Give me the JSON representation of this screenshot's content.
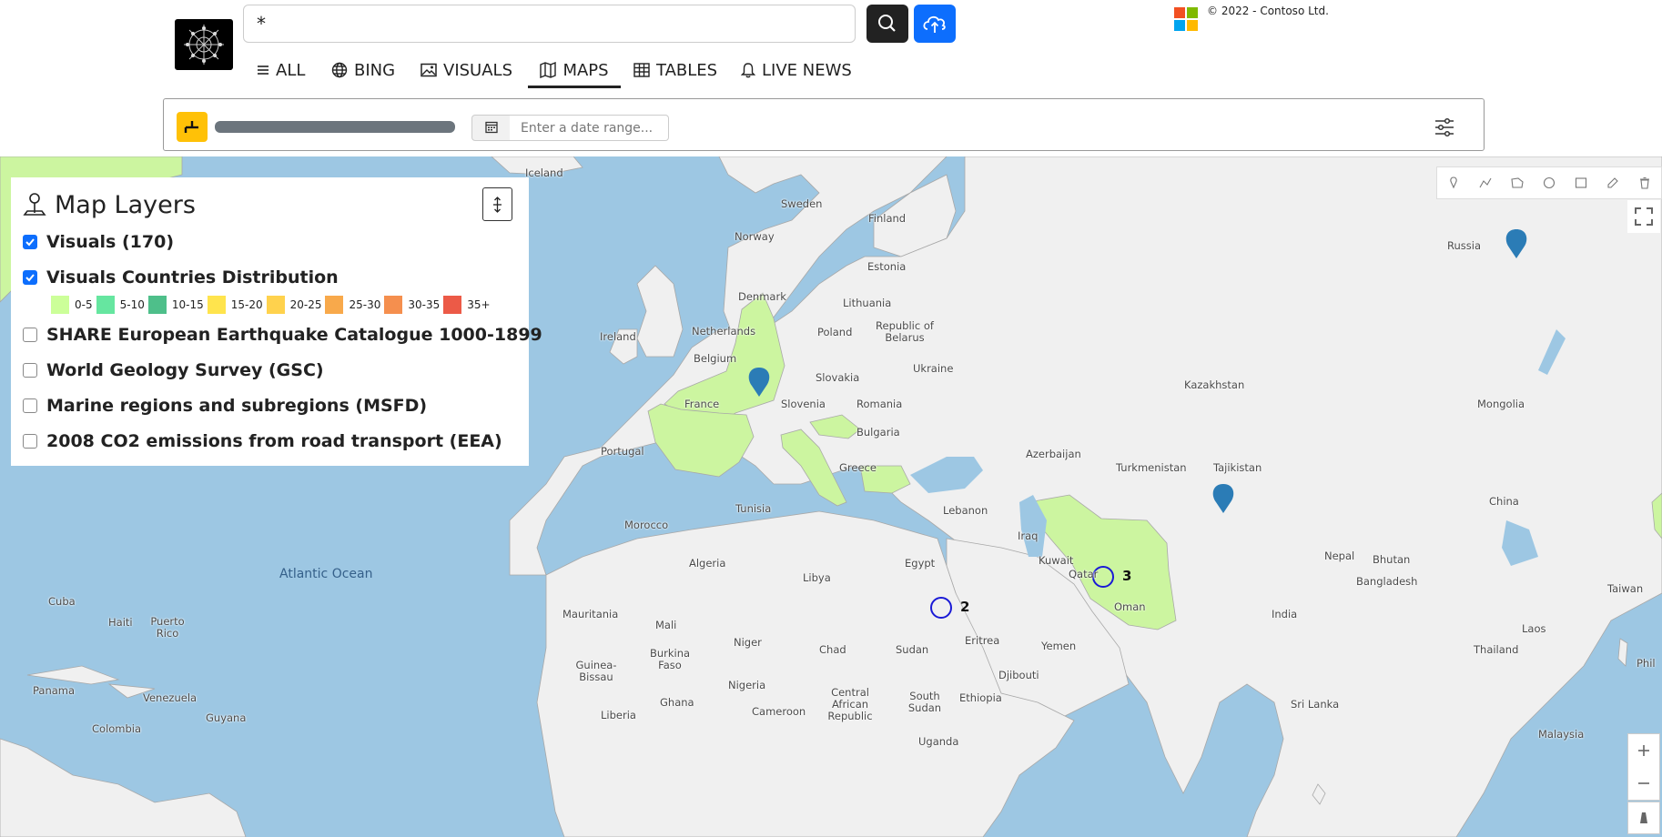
{
  "header": {
    "search_value": "*",
    "copyright": "© 2022 - Contoso Ltd.",
    "tabs": [
      {
        "label": "ALL",
        "icon": "menu-icon"
      },
      {
        "label": "BING",
        "icon": "globe-icon"
      },
      {
        "label": "VISUALS",
        "icon": "image-icon"
      },
      {
        "label": "MAPS",
        "icon": "map-icon",
        "active": true
      },
      {
        "label": "TABLES",
        "icon": "table-icon"
      },
      {
        "label": "LIVE NEWS",
        "icon": "bell-icon"
      }
    ]
  },
  "filter_bar": {
    "date_placeholder": "Enter a date range..."
  },
  "layers_panel": {
    "title": "Map Layers",
    "layers": [
      {
        "label": "Visuals (170)",
        "checked": true
      },
      {
        "label": "Visuals Countries Distribution",
        "checked": true
      },
      {
        "label": "SHARE European Earthquake Catalogue 1000-1899",
        "checked": false
      },
      {
        "label": "World Geology Survey (GSC)",
        "checked": false
      },
      {
        "label": "Marine regions and subregions (MSFD)",
        "checked": false
      },
      {
        "label": "2008 CO2 emissions from road transport (EEA)",
        "checked": false
      }
    ],
    "legend": [
      {
        "label": "0-5",
        "color": "#ccff99"
      },
      {
        "label": "5-10",
        "color": "#66e6a0"
      },
      {
        "label": "10-15",
        "color": "#4ebf8a"
      },
      {
        "label": "15-20",
        "color": "#ffe44d"
      },
      {
        "label": "20-25",
        "color": "#ffd24d"
      },
      {
        "label": "25-30",
        "color": "#f8a94b"
      },
      {
        "label": "30-35",
        "color": "#f58f4e"
      },
      {
        "label": "35+",
        "color": "#ec5a47"
      }
    ]
  },
  "map": {
    "clusters": [
      {
        "count": "2"
      },
      {
        "count": "3"
      }
    ],
    "labels": {
      "iceland": "Iceland",
      "sweden": "Sweden",
      "finland": "Finland",
      "norway": "Norway",
      "russia": "Russia",
      "estonia": "Estonia",
      "denmark": "Denmark",
      "lithuania": "Lithuania",
      "netherlands": "Netherlands",
      "poland": "Poland",
      "republic_of_belarus": "Republic of Belarus",
      "ireland": "Ireland",
      "belgium": "Belgium",
      "ukraine": "Ukraine",
      "slovakia": "Slovakia",
      "france": "France",
      "slovenia": "Slovenia",
      "romania": "Romania",
      "kazakhstan": "Kazakhstan",
      "mongolia": "Mongolia",
      "bulgaria": "Bulgaria",
      "portugal": "Portugal",
      "azerbaijan": "Azerbaijan",
      "turkmenistan": "Turkmenistan",
      "tajikistan": "Tajikistan",
      "greece": "Greece",
      "china": "China",
      "tunisia": "Tunisia",
      "lebanon": "Lebanon",
      "morocco": "Morocco",
      "iraq": "Iraq",
      "kuwait": "Kuwait",
      "algeria": "Algeria",
      "libya": "Libya",
      "egypt": "Egypt",
      "nepal": "Nepal",
      "bhutan": "Bhutan",
      "qatar": "Qatar",
      "bangladesh": "Bangladesh",
      "atlantic_ocean": "Atlantic Ocean",
      "taiwan": "Taiwan",
      "cuba": "Cuba",
      "oman": "Oman",
      "india": "India",
      "mauritania": "Mauritania",
      "haiti": "Haiti",
      "puerto_rico": "Puerto Rico",
      "mali": "Mali",
      "eritrea": "Eritrea",
      "laos": "Laos",
      "niger": "Niger",
      "chad": "Chad",
      "sudan": "Sudan",
      "yemen": "Yemen",
      "thailand": "Thailand",
      "burkina_faso": "Burkina Faso",
      "guinea_bissau": "Guinea-Bissau",
      "djibouti": "Djibouti",
      "phil": "Phil",
      "panama": "Panama",
      "nigeria": "Nigeria",
      "venezuela": "Venezuela",
      "central_african_republic": "Central African Republic",
      "south_sudan": "South Sudan",
      "ethiopia": "Ethiopia",
      "guyana": "Guyana",
      "ghana": "Ghana",
      "cameroon": "Cameroon",
      "sri_lanka": "Sri Lanka",
      "colombia": "Colombia",
      "liberia": "Liberia",
      "uganda": "Uganda",
      "malaysia": "Malaysia"
    }
  },
  "colors": {
    "water": "#9dc7e3",
    "land": "#f0f0f0",
    "highlight": "#ccf5a0",
    "pin": "#2b7cb6",
    "cluster": "#1a1ad6",
    "accent": "#0d6efd",
    "yellow": "#ffc107"
  }
}
